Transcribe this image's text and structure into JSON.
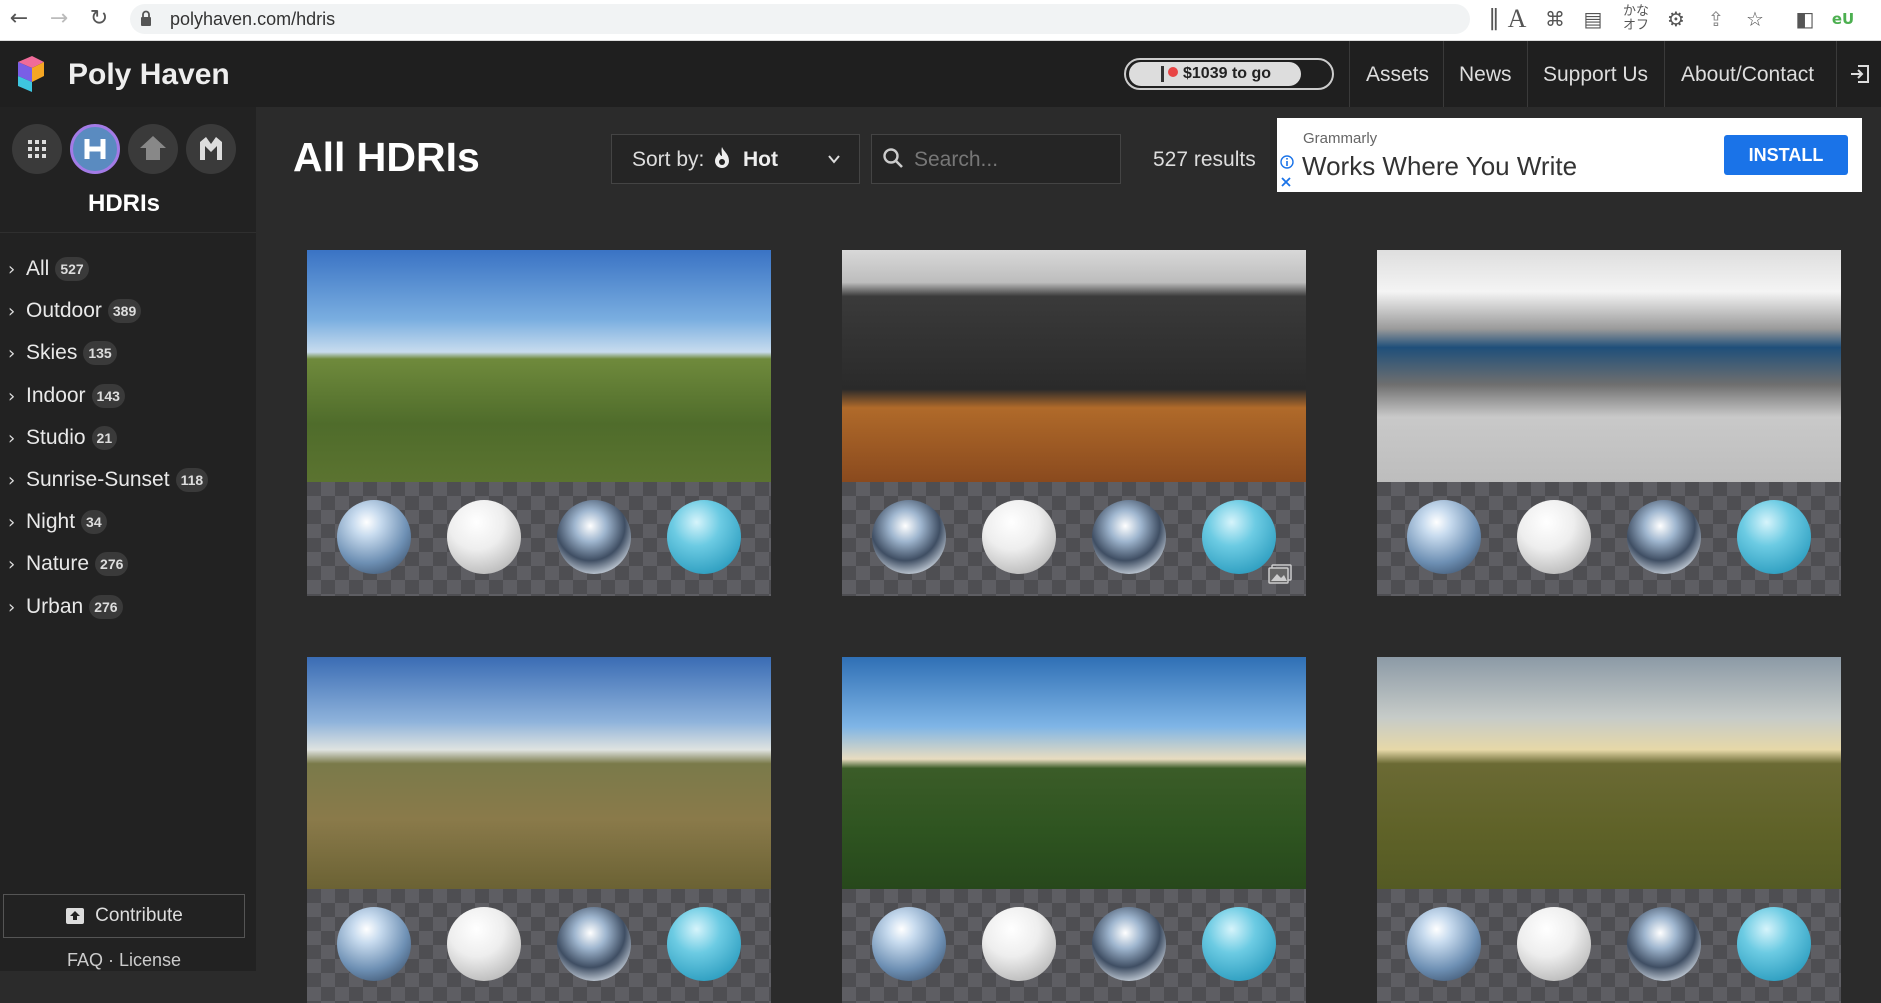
{
  "browser": {
    "url": "polyhaven.com/hdris",
    "back_icon": "arrow-left-icon",
    "forward_icon": "arrow-right-icon",
    "reload_icon": "reload-icon"
  },
  "header": {
    "site_name": "Poly Haven",
    "goal_text": "$1039 to go",
    "nav": [
      "Assets",
      "News",
      "Support Us",
      "About/Contact"
    ],
    "login_icon": "sign-in-icon"
  },
  "sidebar": {
    "asset_types": [
      "all-assets",
      "hdris",
      "textures",
      "models"
    ],
    "title": "HDRIs",
    "categories": [
      {
        "label": "All",
        "count": "527"
      },
      {
        "label": "Outdoor",
        "count": "389"
      },
      {
        "label": "Skies",
        "count": "135"
      },
      {
        "label": "Indoor",
        "count": "143"
      },
      {
        "label": "Studio",
        "count": "21"
      },
      {
        "label": "Sunrise-Sunset",
        "count": "118"
      },
      {
        "label": "Night",
        "count": "34"
      },
      {
        "label": "Nature",
        "count": "276"
      },
      {
        "label": "Urban",
        "count": "276"
      }
    ],
    "contribute_label": "Contribute",
    "footer_links": "FAQ · License"
  },
  "main": {
    "title": "All HDRIs",
    "sort_label": "Sort by:",
    "sort_value": "Hot",
    "search_placeholder": "Search...",
    "result_count": "527 results"
  },
  "ad": {
    "brand": "Grammarly",
    "headline": "Works Where You Write",
    "cta": "INSTALL"
  },
  "colors": {
    "accent_purple": "#a37be6",
    "header_bg": "#1f1f1f",
    "sidebar_bg": "#222222",
    "page_bg": "#2b2b2b",
    "ad_button": "#1a73e8",
    "goal_dot": "#e84545"
  }
}
